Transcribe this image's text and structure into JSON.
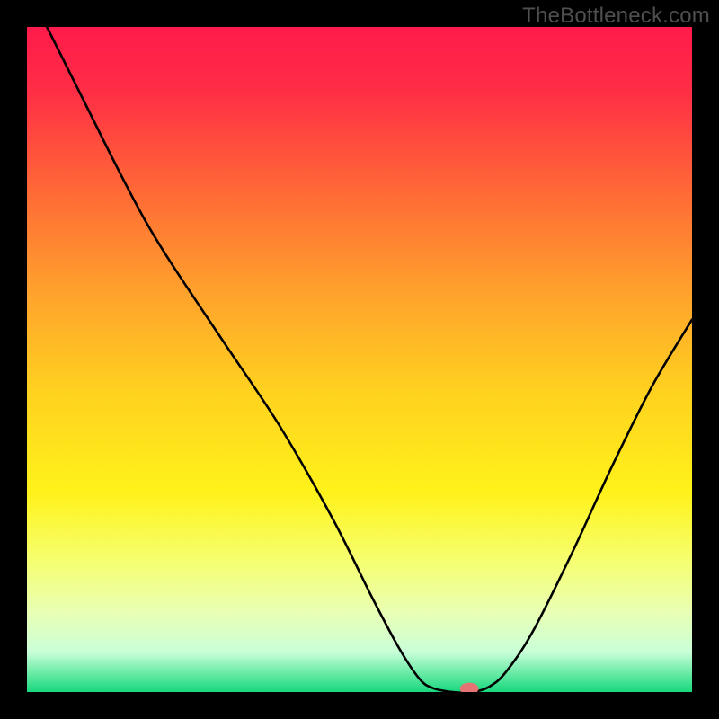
{
  "watermark": "TheBottleneck.com",
  "colors": {
    "page_bg": "#000000",
    "gradient_stops": [
      {
        "offset": 0.0,
        "color": "#ff1a4b"
      },
      {
        "offset": 0.1,
        "color": "#ff2f45"
      },
      {
        "offset": 0.25,
        "color": "#ff6a36"
      },
      {
        "offset": 0.4,
        "color": "#ffa22c"
      },
      {
        "offset": 0.55,
        "color": "#ffd21f"
      },
      {
        "offset": 0.7,
        "color": "#fff21a"
      },
      {
        "offset": 0.8,
        "color": "#f6ff6e"
      },
      {
        "offset": 0.88,
        "color": "#e9ffb4"
      },
      {
        "offset": 0.94,
        "color": "#c9ffd8"
      },
      {
        "offset": 0.975,
        "color": "#5fe8a0"
      },
      {
        "offset": 1.0,
        "color": "#17d87e"
      }
    ],
    "curve": "#000000",
    "marker": "#e57373"
  },
  "chart_data": {
    "type": "line",
    "title": "",
    "xlabel": "",
    "ylabel": "",
    "xlim": [
      0,
      100
    ],
    "ylim": [
      0,
      100
    ],
    "curve_points": [
      {
        "x": 3.0,
        "y": 100.0
      },
      {
        "x": 8.0,
        "y": 90.0
      },
      {
        "x": 14.0,
        "y": 78.0
      },
      {
        "x": 18.0,
        "y": 70.5
      },
      {
        "x": 22.0,
        "y": 64.0
      },
      {
        "x": 30.0,
        "y": 52.0
      },
      {
        "x": 38.0,
        "y": 40.0
      },
      {
        "x": 46.0,
        "y": 26.0
      },
      {
        "x": 52.0,
        "y": 14.0
      },
      {
        "x": 56.0,
        "y": 6.5
      },
      {
        "x": 59.0,
        "y": 2.0
      },
      {
        "x": 61.0,
        "y": 0.6
      },
      {
        "x": 64.0,
        "y": 0.0
      },
      {
        "x": 67.0,
        "y": 0.0
      },
      {
        "x": 69.5,
        "y": 0.8
      },
      {
        "x": 72.0,
        "y": 3.0
      },
      {
        "x": 76.0,
        "y": 9.0
      },
      {
        "x": 82.0,
        "y": 21.0
      },
      {
        "x": 88.0,
        "y": 34.0
      },
      {
        "x": 94.0,
        "y": 46.0
      },
      {
        "x": 100.0,
        "y": 56.0
      }
    ],
    "marker": {
      "x": 66.5,
      "y": 0.0,
      "rx": 1.4,
      "ry": 0.9
    }
  }
}
